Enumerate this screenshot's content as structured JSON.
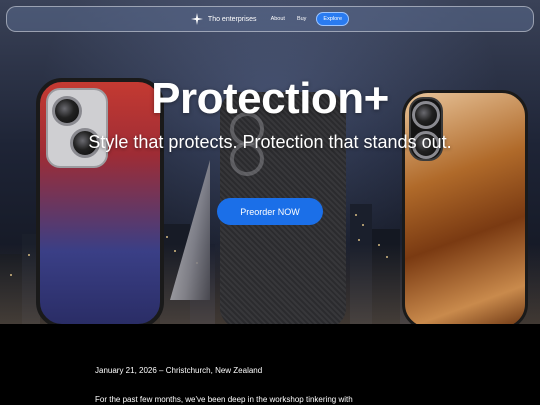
{
  "nav": {
    "brand_name": "Tho enterprises",
    "links": [
      "About",
      "Buy"
    ],
    "explore_label": "Explore"
  },
  "hero": {
    "headline": "Protection+",
    "tagline": "Style that protects. Protection that stands out.",
    "cta_label": "Preorder NOW"
  },
  "article": {
    "dateline": "January 21, 2026 – Christchurch, New Zealand",
    "first_paragraph": "For the past few months, we've been deep in the workshop tinkering with"
  },
  "colors": {
    "accent": "#1b6fe8",
    "nav_bg": "#5a698c",
    "page_bg": "#000000"
  },
  "icons": {
    "brand": "sparkle-icon"
  }
}
